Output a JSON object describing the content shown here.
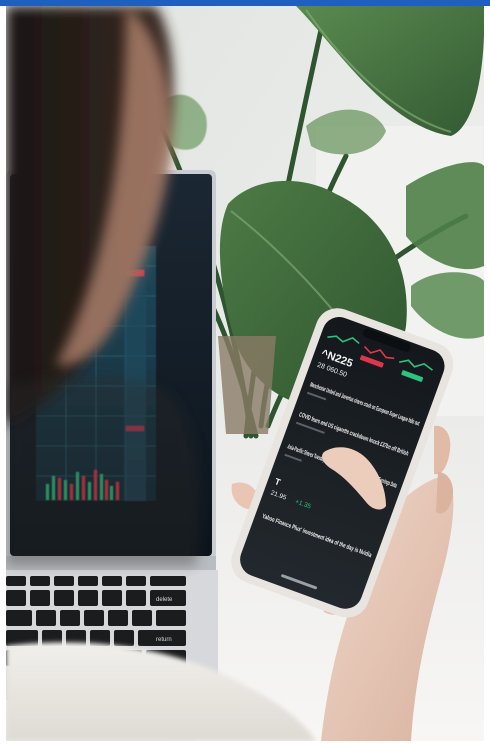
{
  "photo": {
    "alt": "",
    "phone_screen": {
      "index_name": "^N225",
      "index_value": "28 060.50",
      "headlines": [
        "Manchester United and Juventus shares crash on European Super League fallo out",
        "COVID fears and US cigarette crackdown knock £37bn off British",
        "Asia-Pacific Shares Tuesday: Investors Weigh Potential Impact of Q1 Earnings Data",
        "Yahoo Finance Plus' investment idea of the day is Nvidia"
      ],
      "ticker_symbol": "T",
      "ticker_value": "21.95",
      "ticker_change": "+1.35"
    },
    "keyboard_keys": [
      "delete",
      "return"
    ],
    "colors": {
      "accent_bar": "#1f5fbf",
      "chart_green": "#2ec27e",
      "chart_red": "#e0364c",
      "phone_case": "#e8e4df",
      "leaf": "#3f6b3b"
    }
  }
}
